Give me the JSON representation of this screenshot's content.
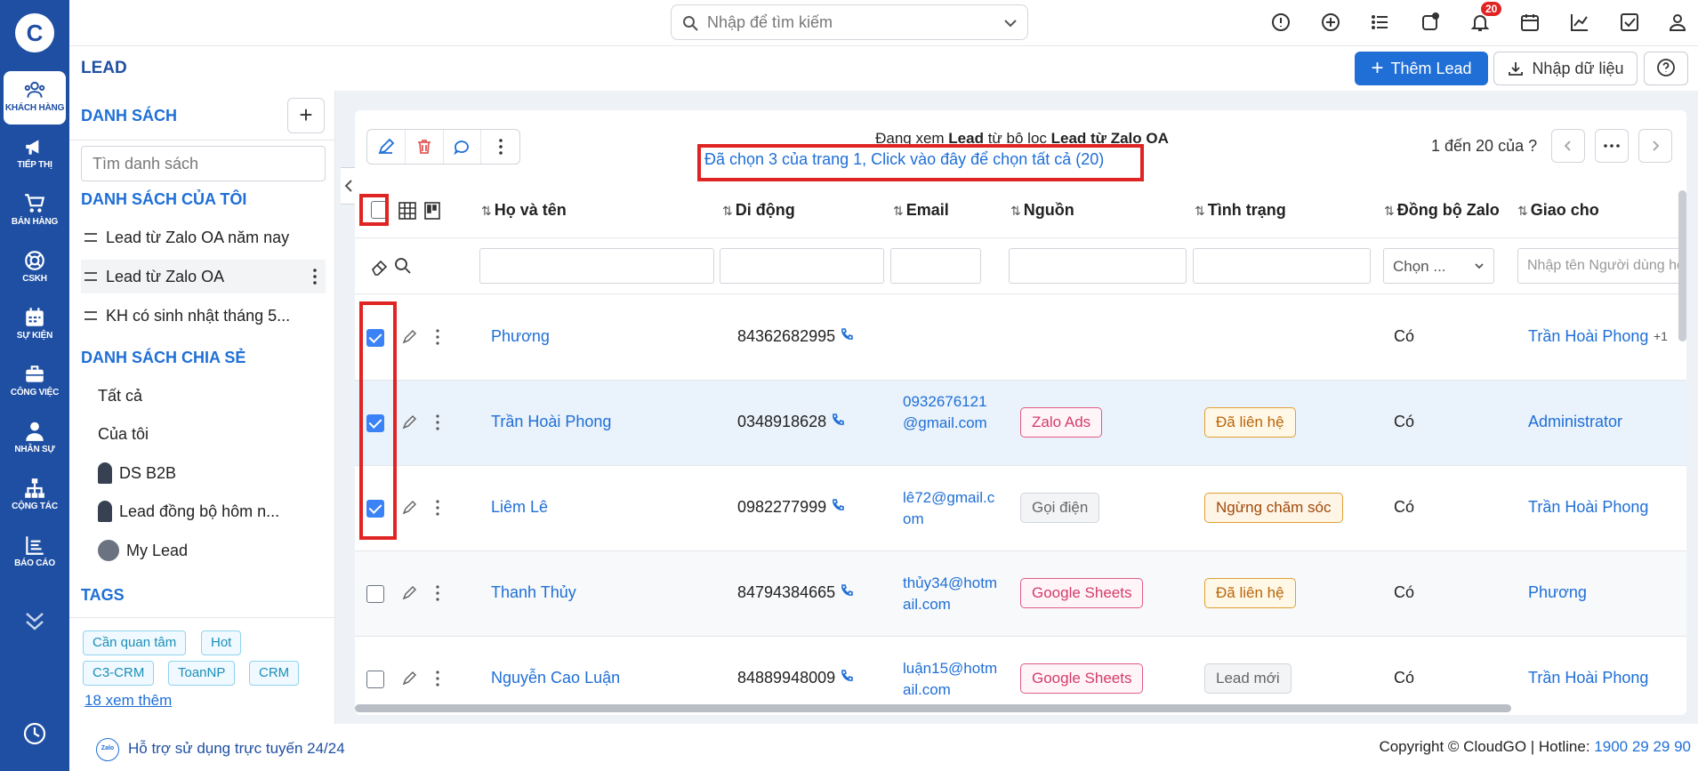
{
  "rail": {
    "logo": "C",
    "items": [
      {
        "label": "KHÁCH HÀNG",
        "icon": "users-icon",
        "active": true
      },
      {
        "label": "TIẾP THỊ",
        "icon": "megaphone-icon"
      },
      {
        "label": "BÁN HÀNG",
        "icon": "cart-icon"
      },
      {
        "label": "CSKH",
        "icon": "lifebuoy-icon"
      },
      {
        "label": "SỰ KIỆN",
        "icon": "calendar-icon"
      },
      {
        "label": "CÔNG VIỆC",
        "icon": "briefcase-icon"
      },
      {
        "label": "NHÂN SỰ",
        "icon": "person-icon"
      },
      {
        "label": "CỘNG TÁC",
        "icon": "hierarchy-icon"
      },
      {
        "label": "BÁO CÁO",
        "icon": "report-icon"
      }
    ]
  },
  "topbar": {
    "search_placeholder": "Nhập để tìm kiếm",
    "notification_count": "20"
  },
  "header": {
    "title": "LEAD",
    "add_button": "Thêm Lead",
    "import_button": "Nhập dữ liệu"
  },
  "sidebar": {
    "lists_title": "DANH SÁCH",
    "search_placeholder": "Tìm danh sách",
    "my_lists_title": "DANH SÁCH CỦA TÔI",
    "my_lists": [
      "Lead từ Zalo OA năm nay",
      "Lead từ Zalo OA",
      "KH có sinh nhật tháng 5..."
    ],
    "shared_title": "DANH SÁCH CHIA SẺ",
    "shared": [
      "Tất cả",
      "Của tôi",
      "DS B2B",
      "Lead đồng bộ hôm n...",
      "My Lead"
    ],
    "tags_title": "TAGS",
    "tags": [
      "Cần quan tâm",
      "Hot",
      "C3-CRM",
      "ToanNP",
      "CRM"
    ],
    "more_tags": "18 xem thêm"
  },
  "toolbar": {
    "filter_prefix": "Đang xem ",
    "filter_module": "Lead",
    "filter_mid": " từ bộ lọc ",
    "filter_name": "Lead từ Zalo OA",
    "selection_text": "Đã chọn 3 của trang 1, Click vào đây để chọn tất cả (20)",
    "pager_text": "1 đến 20 của ?"
  },
  "table": {
    "columns": [
      "Họ và tên",
      "Di động",
      "Email",
      "Nguồn",
      "Tình trạng",
      "Đồng bộ Zalo",
      "Giao cho"
    ],
    "filter_select": "Chọn ...",
    "filter_assignee_placeholder": "Nhập tên Người dùng hoặc nhóm",
    "rows": [
      {
        "checked": true,
        "name": "Phương",
        "phone": "84362682995",
        "email": "",
        "source": "",
        "status": "",
        "zalo": "Có",
        "assignee": "Trần Hoài Phong",
        "extra": "+1"
      },
      {
        "checked": true,
        "name": "Trần Hoài Phong",
        "phone": "0348918628",
        "email": "0932676121@gmail.com",
        "source": "Zalo Ads",
        "status": "Đã liên hệ",
        "zalo": "Có",
        "assignee": "Administrator",
        "extra": ""
      },
      {
        "checked": true,
        "name": "Liêm Lê",
        "phone": "0982277999",
        "email": "lê72@gmail.com",
        "source": "Gọi điện",
        "status": "Ngừng chăm sóc",
        "zalo": "Có",
        "assignee": "Trần Hoài Phong",
        "extra": ""
      },
      {
        "checked": false,
        "name": "Thanh Thủy",
        "phone": "84794384665",
        "email": "thủy34@hotmail.com",
        "source": "Google Sheets",
        "status": "Đã liên hệ",
        "zalo": "Có",
        "assignee": "Phương",
        "extra": ""
      },
      {
        "checked": false,
        "name": "Nguyễn Cao Luận",
        "phone": "84889948009",
        "email": "luận15@hotmail.com",
        "source": "Google Sheets",
        "status": "Lead mới",
        "zalo": "Có",
        "assignee": "Trần Hoài Phong",
        "extra": ""
      }
    ]
  },
  "footer": {
    "zalo_badge": "Zalo",
    "support": "Hỗ trợ sử dụng trực tuyến 24/24",
    "copyright": "Copyright © CloudGO | Hotline: ",
    "hotline": "1900 29 29 90"
  },
  "colors": {
    "brand": "#1f4fa3",
    "accent": "#1f6fd6",
    "highlight": "#e02424"
  }
}
